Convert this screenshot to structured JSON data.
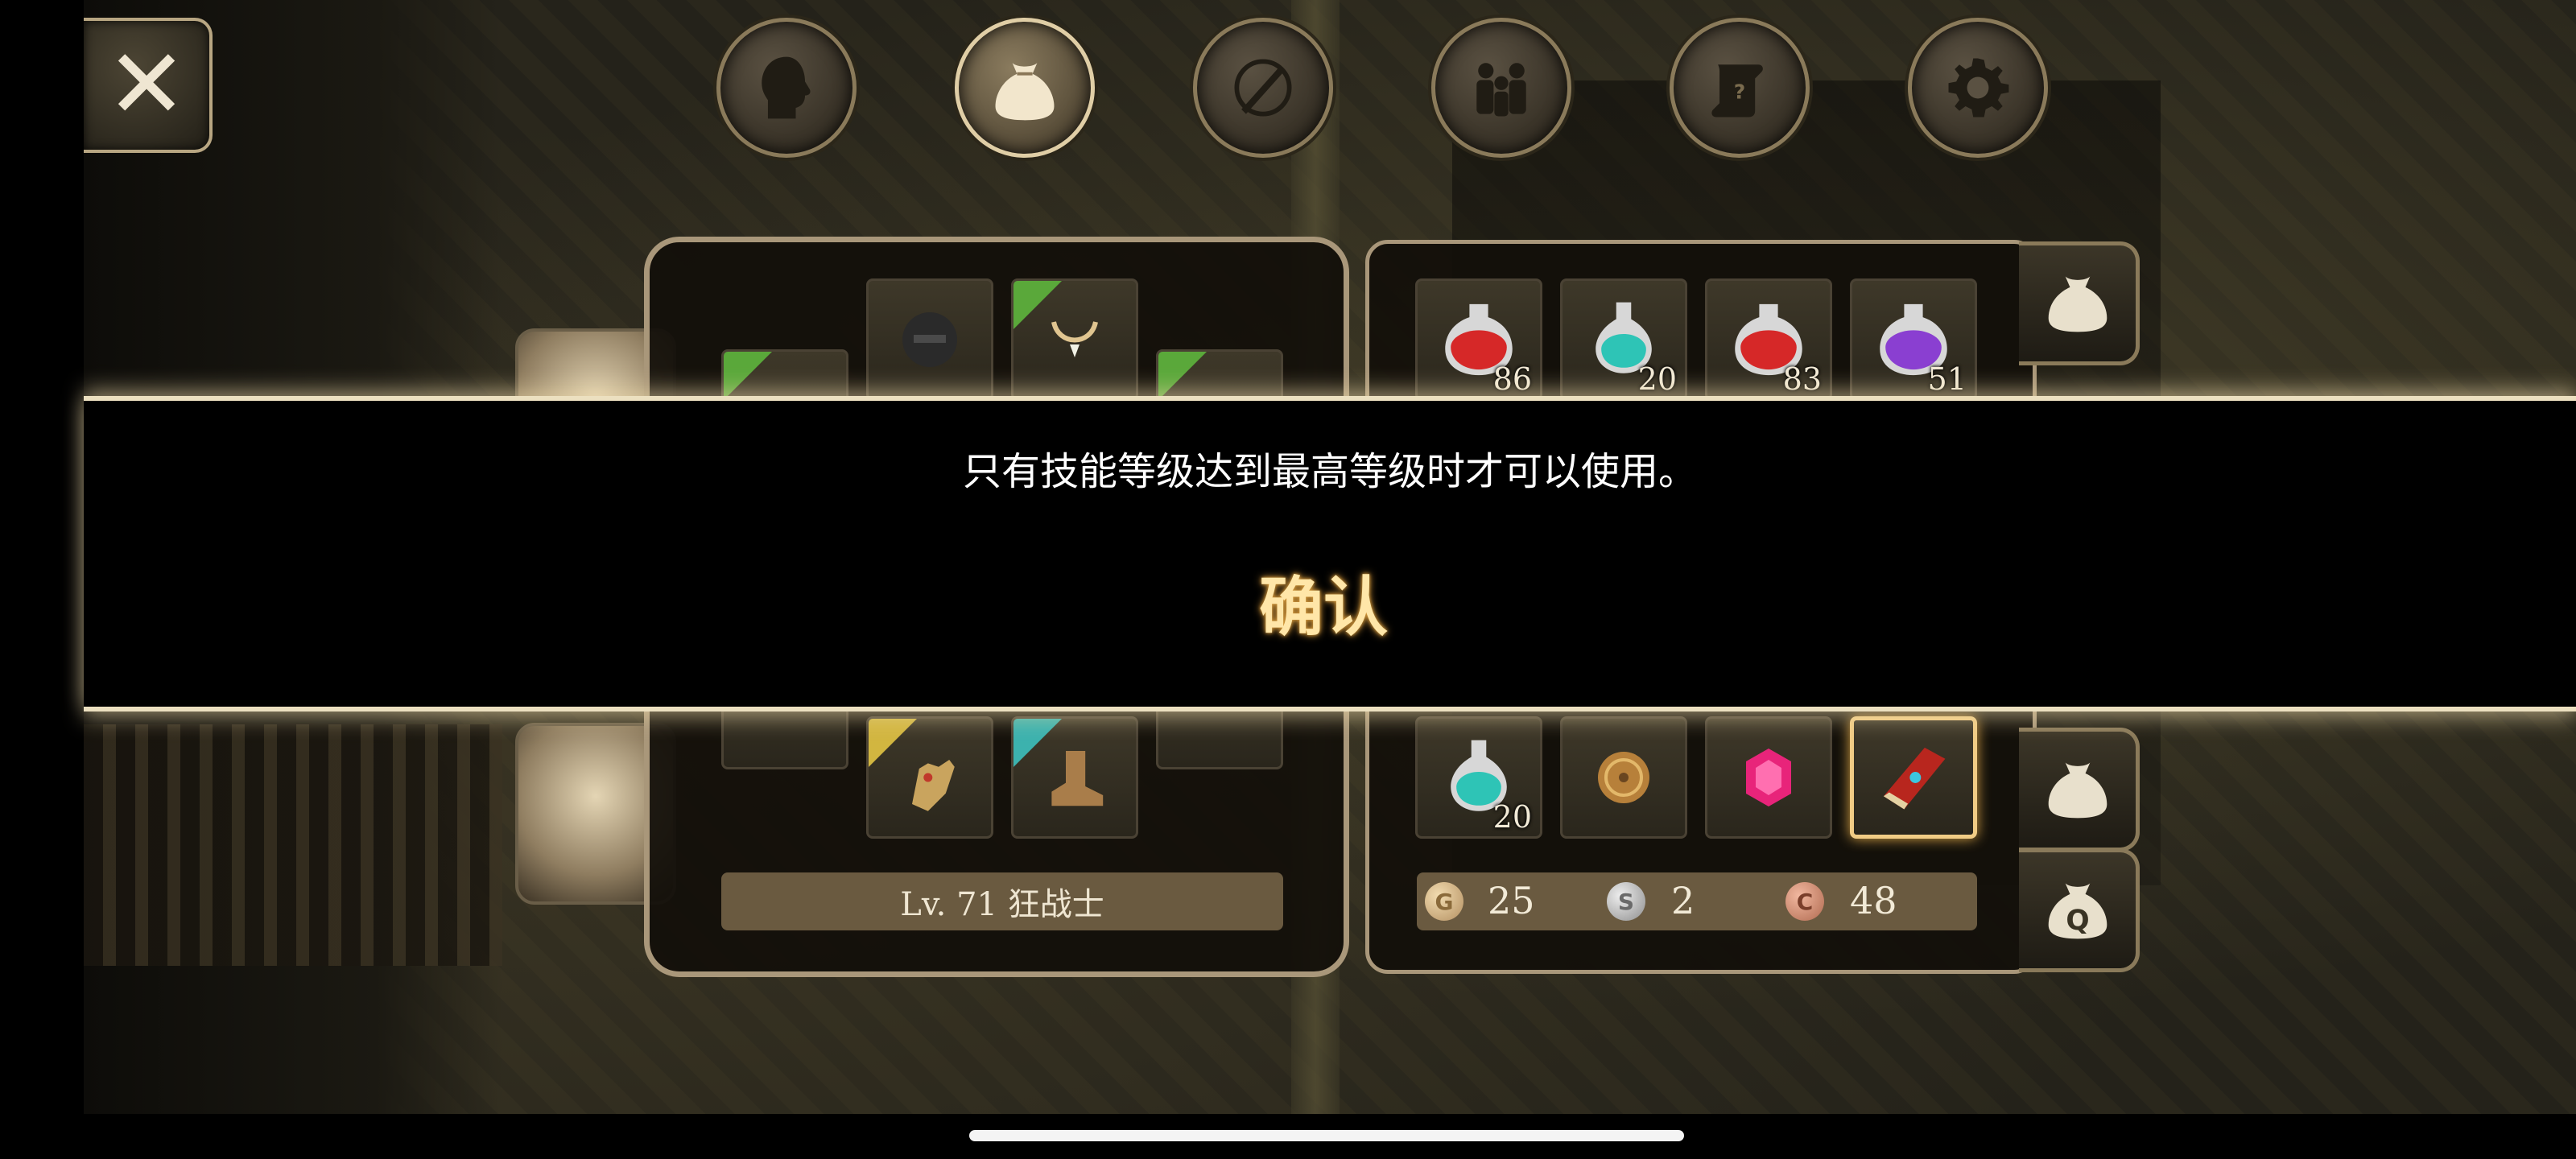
{
  "top_nav": {
    "tabs": [
      {
        "icon": "head-icon",
        "active": false
      },
      {
        "icon": "bag-icon",
        "active": true
      },
      {
        "icon": "compass-sword-icon",
        "active": false
      },
      {
        "icon": "party-icon",
        "active": false
      },
      {
        "icon": "quest-scroll-icon",
        "active": false
      },
      {
        "icon": "gear-icon",
        "active": false
      }
    ]
  },
  "close_button": {
    "label": "✕"
  },
  "equipment": {
    "level_label": "Lv. 71 狂战士"
  },
  "inventory": {
    "top_row": [
      {
        "icon": "red-potion-icon",
        "qty": "86"
      },
      {
        "icon": "teal-potion-icon",
        "qty": "20"
      },
      {
        "icon": "red-potion-icon",
        "qty": "83"
      },
      {
        "icon": "purple-potion-icon",
        "qty": "51"
      }
    ],
    "bottom_row": [
      {
        "icon": "teal-potion-icon",
        "qty": "20"
      },
      {
        "icon": "coin-medal-icon",
        "qty": ""
      },
      {
        "icon": "pink-gem-icon",
        "qty": ""
      },
      {
        "icon": "skill-book-icon",
        "qty": "",
        "selected": true
      }
    ],
    "currency": {
      "gold_symbol": "G",
      "silver_symbol": "S",
      "copper_symbol": "C",
      "gold": "25",
      "silver": "2",
      "copper": "48"
    },
    "side_tabs": [
      {
        "icon": "bag-icon"
      },
      {
        "icon": "bag-icon"
      },
      {
        "icon": "bag-q-icon",
        "letter": "Q"
      }
    ]
  },
  "dialog": {
    "message": "只有技能等级达到最高等级时才可以使用。",
    "confirm_label": "确认"
  },
  "colors": {
    "accent_gold": "#f1cc85",
    "frame": "#a9977a",
    "rarity_green": "#5aa83a",
    "rarity_yellow": "#d2b640",
    "rarity_cyan": "#3cb2ae"
  }
}
